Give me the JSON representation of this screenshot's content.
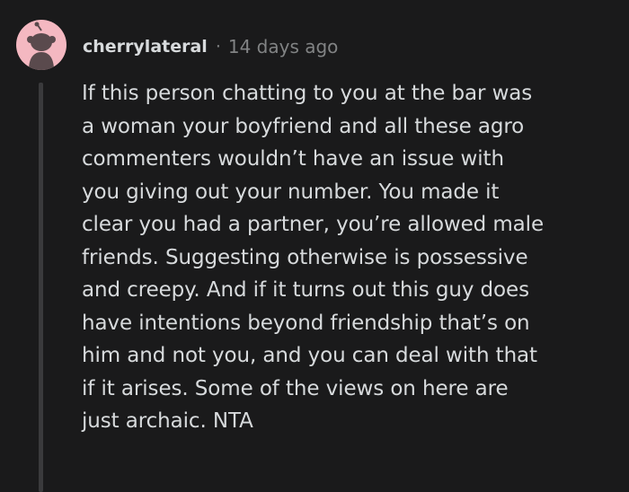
{
  "comment": {
    "avatar_icon": "snoo-avatar-icon",
    "username": "cherrylateral",
    "separator": "·",
    "timestamp": "14 days ago",
    "body": "If this person chatting to you at the bar was\na woman your boyfriend and all these agro\ncommenters wouldn’t have an issue with\nyou giving out your number. You made it\nclear you had a partner, you’re allowed male\nfriends. Suggesting otherwise is possessive\nand creepy. And if it turns out this guy does\nhave intentions beyond friendship that’s on\nhim and not you, and you can deal with that\nif it arises. Some of the views on here are\njust archaic. NTA"
  },
  "colors": {
    "background": "#1a1a1b",
    "text": "#d7dadc",
    "muted": "#818384",
    "avatar_bg": "#f4b8c1",
    "avatar_figure": "#5a4a4d",
    "thread_line": "#3a3a3c"
  }
}
